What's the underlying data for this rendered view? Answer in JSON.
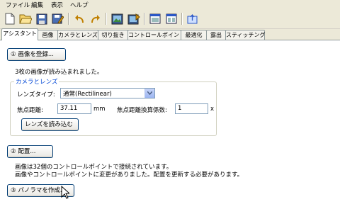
{
  "menu": [
    "ファイル",
    "編集",
    "表示",
    "ヘルプ"
  ],
  "toolbar_icons": [
    "new-icon",
    "open-icon",
    "save-icon",
    "save-as-icon",
    "undo-icon",
    "redo-icon",
    "preview-icon",
    "fast-preview-icon",
    "images-window-icon",
    "control-points-window-icon",
    "upload-icon"
  ],
  "tabs": [
    "アシスタント",
    "画像",
    "カメラとレンズ",
    "切り抜き",
    "コントロールポイント",
    "最適化",
    "露出",
    "スティッチング"
  ],
  "assistant": {
    "load_button": "① 画像を登録...",
    "loaded_msg": "3枚の画像が読み込まれました。",
    "camera_group": {
      "title": "カメラとレンズ",
      "lens_type_label": "レンズタイプ:",
      "lens_type_value": "通常(Rectilinear)",
      "focal_label": "焦点距離:",
      "focal_value": "37.11",
      "focal_unit": "mm",
      "crop_label": "焦点距離換算係数:",
      "crop_value": "1",
      "crop_unit": "x",
      "load_lens_button": "レンズを読み込む"
    },
    "align_button": "② 配置...",
    "cp_msg_1": "画像は32個のコントロールポイントで接続されています。",
    "cp_msg_2": "画像やコントロールポイントに変更がありました。配置を更新する必要があります。",
    "create_button": "③ パノラマを作成..."
  },
  "colors": {
    "accent": "#0046d5",
    "button_border": "#003c74"
  }
}
